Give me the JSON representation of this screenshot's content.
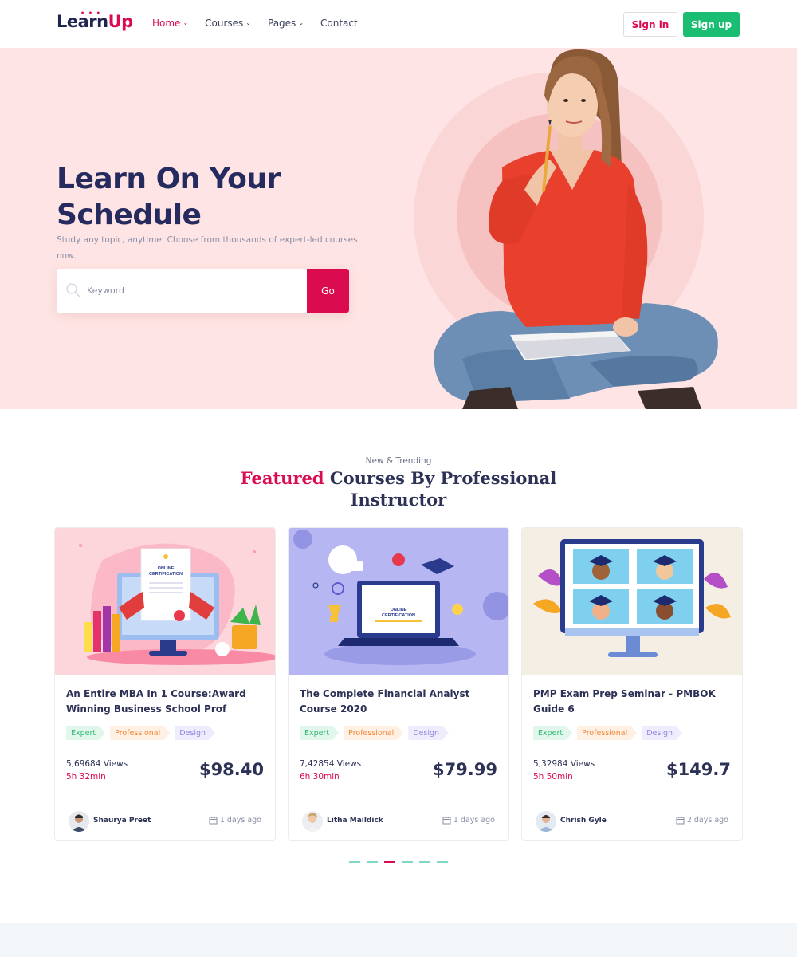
{
  "header": {
    "logo": {
      "part1": "Learn",
      "part2": "Up"
    },
    "nav": [
      {
        "label": "Home",
        "chevron": true,
        "active": true
      },
      {
        "label": "Courses",
        "chevron": true,
        "active": false
      },
      {
        "label": "Pages",
        "chevron": true,
        "active": false
      },
      {
        "label": "Contact",
        "chevron": false,
        "active": false
      }
    ],
    "signin_label": "Sign in",
    "signup_label": "Sign up"
  },
  "hero": {
    "title_line1": "Learn On Your",
    "title_line2": "Schedule",
    "subtitle": "Study any topic, anytime. Choose from thousands of expert-led courses now.",
    "search_placeholder": "Keyword",
    "go_label": "Go"
  },
  "featured": {
    "eyebrow": "New & Trending",
    "title_accent": "Featured",
    "title_rest": "Courses By Professional Instructor"
  },
  "courses": [
    {
      "title": "An Entire MBA In 1 Course:Award Winning Business School Prof",
      "tags": [
        "Expert",
        "Professional",
        "Design"
      ],
      "views": "5,69684 Views",
      "duration": "5h 32min",
      "price": "$98.40",
      "author": "Shaurya Preet",
      "date": "1 days ago"
    },
    {
      "title": "The Complete Financial Analyst Course 2020",
      "tags": [
        "Expert",
        "Professional",
        "Design"
      ],
      "views": "7,42854 Views",
      "duration": "6h 30min",
      "price": "$79.99",
      "author": "Litha Maildick",
      "date": "1 days ago"
    },
    {
      "title": "PMP Exam Prep Seminar - PMBOK Guide 6",
      "tags": [
        "Expert",
        "Professional",
        "Design"
      ],
      "views": "5,32984 Views",
      "duration": "5h 50min",
      "price": "$149.7",
      "author": "Chrish Gyle",
      "date": "2 days ago"
    }
  ],
  "carousel": {
    "count": 6,
    "active_index": 2
  },
  "colors": {
    "accent": "#da0b4e",
    "success": "#1bbd72",
    "navy": "#252b5e",
    "hero_bg": "#fee4e4"
  }
}
